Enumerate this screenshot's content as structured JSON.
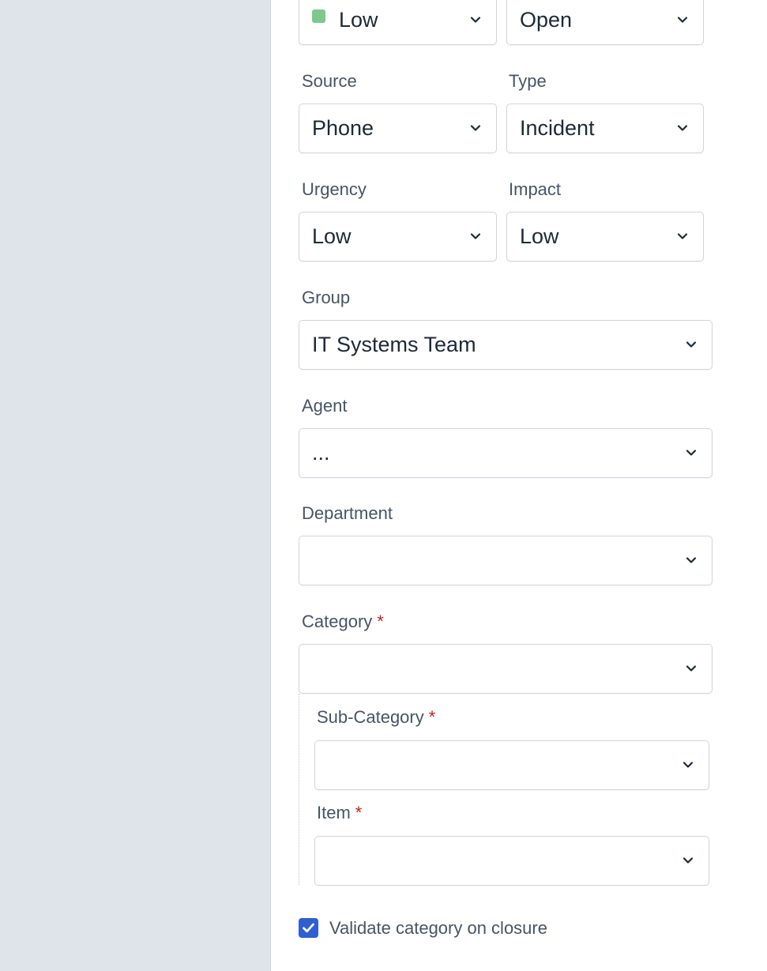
{
  "priority": {
    "value": "Low",
    "color": "#7cc98b"
  },
  "status": {
    "value": "Open"
  },
  "source": {
    "label": "Source",
    "value": "Phone"
  },
  "type": {
    "label": "Type",
    "value": "Incident"
  },
  "urgency": {
    "label": "Urgency",
    "value": "Low"
  },
  "impact": {
    "label": "Impact",
    "value": "Low"
  },
  "group": {
    "label": "Group",
    "value": "IT Systems Team"
  },
  "agent": {
    "label": "Agent",
    "value": "..."
  },
  "department": {
    "label": "Department",
    "value": ""
  },
  "category": {
    "label": "Category",
    "required_mark": "*",
    "value": ""
  },
  "sub_category": {
    "label": "Sub-Category",
    "required_mark": "*",
    "value": ""
  },
  "item": {
    "label": "Item",
    "required_mark": "*",
    "value": ""
  },
  "validate": {
    "label": "Validate category on closure",
    "checked": true
  },
  "colors": {
    "accent": "#2f5fd0",
    "required": "#c81e1e",
    "sidebar_bg": "#dfe3ea"
  }
}
